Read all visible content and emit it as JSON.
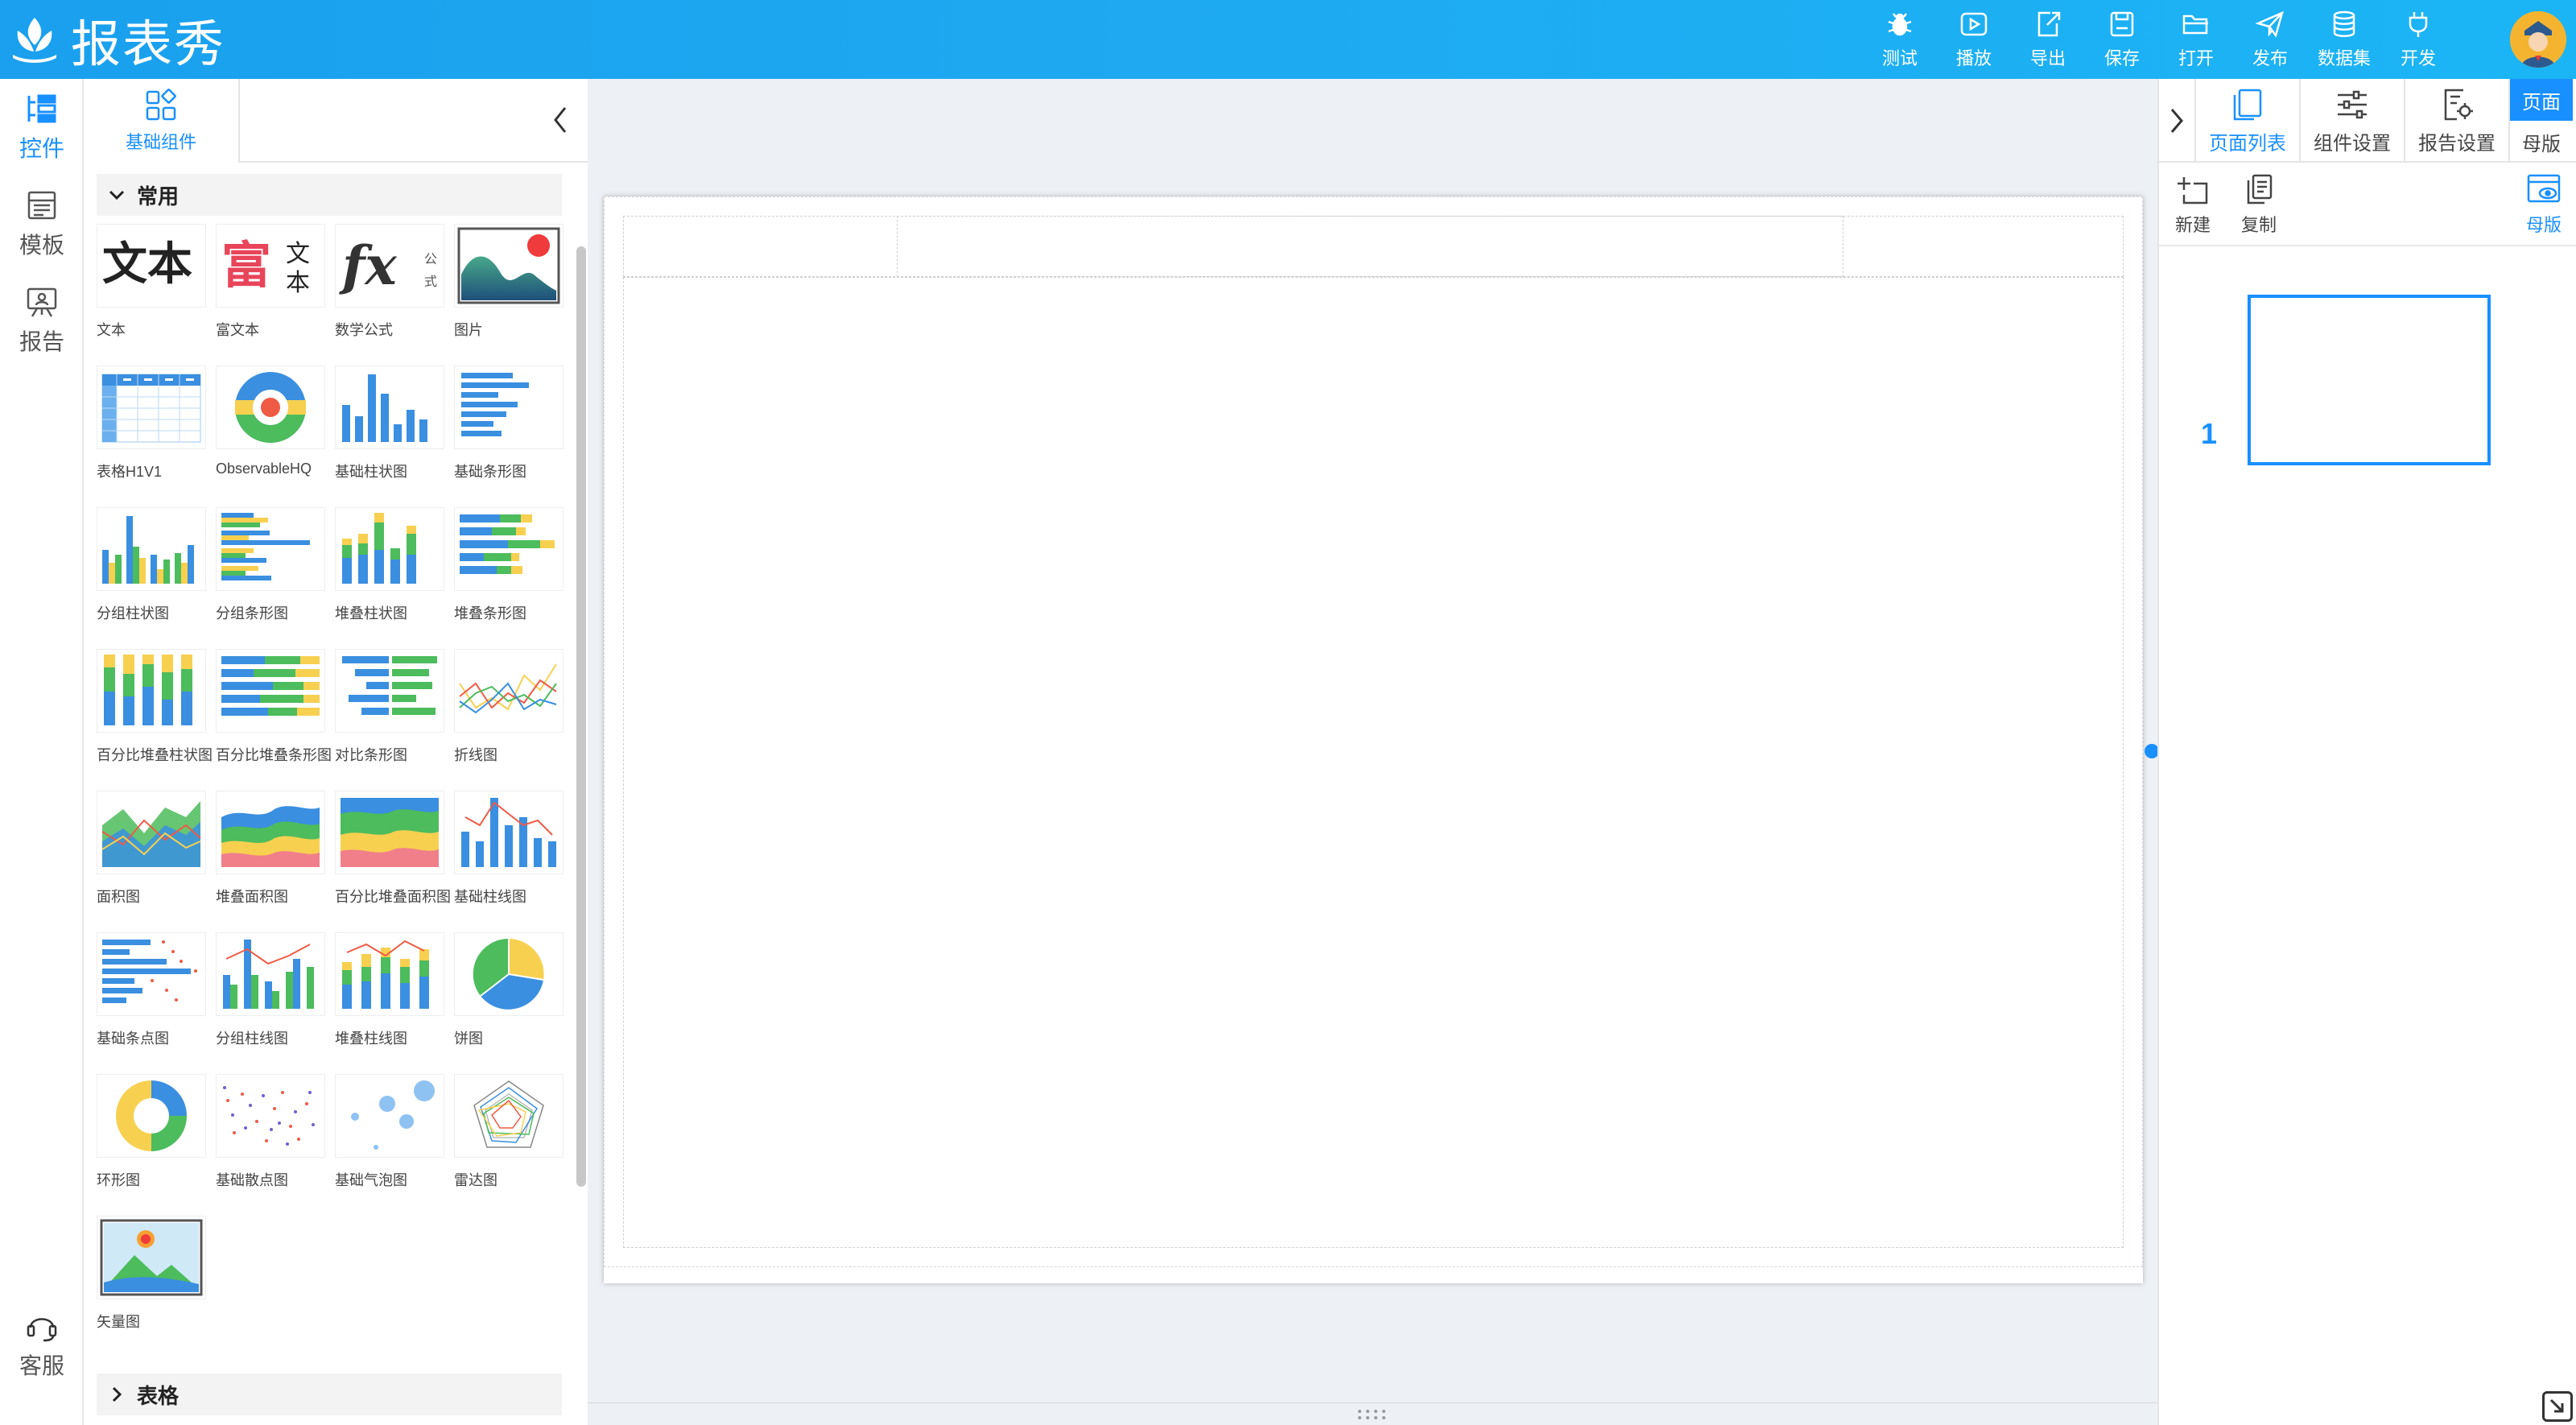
{
  "app": {
    "title": "报表秀"
  },
  "toolbar": [
    {
      "id": "test",
      "label": "测试",
      "icon": "bug-icon"
    },
    {
      "id": "play",
      "label": "播放",
      "icon": "play-icon"
    },
    {
      "id": "export",
      "label": "导出",
      "icon": "export-icon"
    },
    {
      "id": "save",
      "label": "保存",
      "icon": "save-icon"
    },
    {
      "id": "open",
      "label": "打开",
      "icon": "folder-open-icon"
    },
    {
      "id": "publish",
      "label": "发布",
      "icon": "send-icon"
    },
    {
      "id": "dataset",
      "label": "数据集",
      "icon": "database-icon"
    },
    {
      "id": "develop",
      "label": "开发",
      "icon": "plug-icon"
    }
  ],
  "rail": {
    "items": [
      {
        "label": "控件",
        "icon": "widgets-icon",
        "active": true
      },
      {
        "label": "模板",
        "icon": "template-icon",
        "active": false
      },
      {
        "label": "报告",
        "icon": "report-icon",
        "active": false
      }
    ],
    "support": {
      "label": "客服",
      "icon": "headset-icon"
    }
  },
  "panel": {
    "tab_label": "基础组件",
    "sections": [
      {
        "title": "常用",
        "items": [
          "文本",
          "富文本",
          "数学公式",
          "图片",
          "表格H1V1",
          "ObservableHQ",
          "基础柱状图",
          "基础条形图",
          "分组柱状图",
          "分组条形图",
          "堆叠柱状图",
          "堆叠条形图",
          "百分比堆叠柱状图",
          "百分比堆叠条形图",
          "对比条形图",
          "折线图",
          "面积图",
          "堆叠面积图",
          "百分比堆叠面积图",
          "基础柱线图",
          "基础条点图",
          "分组柱线图",
          "堆叠柱线图",
          "饼图",
          "环形图",
          "基础散点图",
          "基础气泡图",
          "雷达图",
          "矢量图"
        ]
      }
    ],
    "collapsed_section": "表格",
    "thumb_text": {
      "text": "文本",
      "rich": "富",
      "rich_side": "文本",
      "formula": "fx",
      "formula_side": "公式"
    }
  },
  "right_panel": {
    "tabs": [
      {
        "label": "页面列表",
        "icon": "pages-icon",
        "active": true
      },
      {
        "label": "组件设置",
        "icon": "sliders-icon",
        "active": false
      },
      {
        "label": "报告设置",
        "icon": "report-settings-icon",
        "active": false
      }
    ],
    "toggle": [
      {
        "label": "页面",
        "active": true
      },
      {
        "label": "母版",
        "active": false
      }
    ],
    "actions": [
      {
        "label": "新建",
        "icon": "add-page-icon"
      },
      {
        "label": "复制",
        "icon": "copy-icon"
      }
    ],
    "master_action": {
      "label": "母版",
      "icon": "master-view-icon"
    },
    "pages": [
      {
        "number": "1"
      }
    ]
  },
  "colors": {
    "accent": "#1890ff",
    "header": "#1ea6f0",
    "workspace": "#edf0f4"
  }
}
